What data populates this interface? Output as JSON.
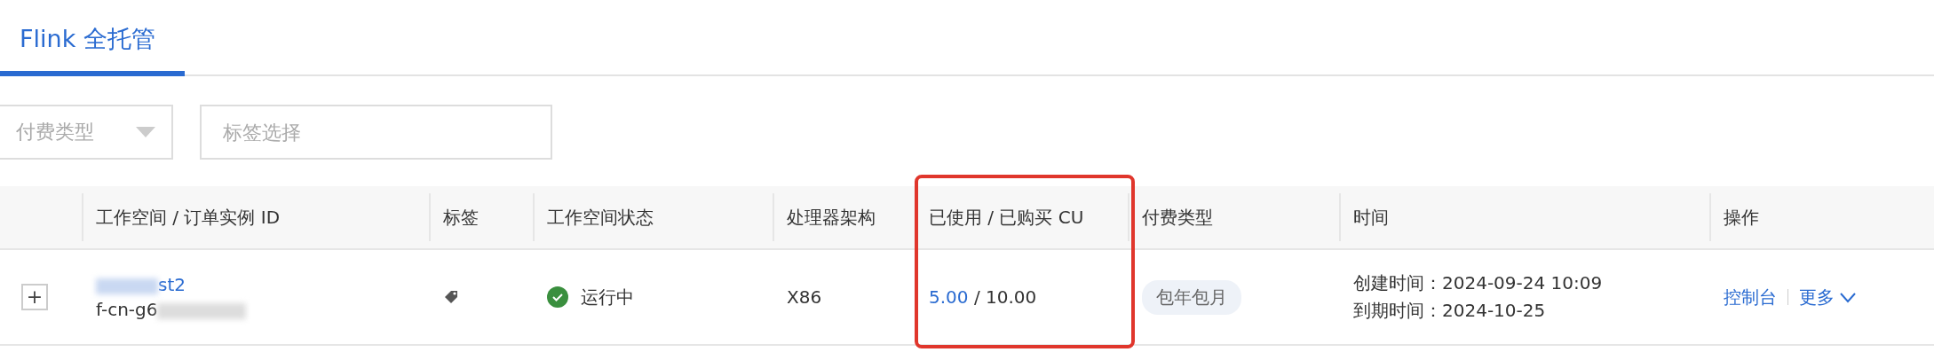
{
  "tabs": [
    {
      "label": "Flink 全托管",
      "selected": true
    }
  ],
  "filters": {
    "pay_type": {
      "placeholder": "付费类型"
    },
    "tags": {
      "placeholder": "标签选择"
    }
  },
  "table": {
    "columns": [
      "工作空间 / 订单实例 ID",
      "标签",
      "工作空间状态",
      "处理器架构",
      "已使用 / 已购买 CU",
      "付费类型",
      "时间",
      "操作"
    ],
    "rows": [
      {
        "expanded": false,
        "expand_symbol": "+",
        "workspace_name": "st2",
        "instance_id": "f-cn-g6",
        "status": "运行中",
        "kind": "running",
        "arch": "X86",
        "cu_used": "5.00",
        "cu_separator": "/",
        "cu_total": "10.00",
        "pay_type": "包年包月",
        "created": "创建时间：2024-09-24 10:09",
        "expires": "到期时间：2024-10-25",
        "actions": [
          "控制台",
          "更多"
        ]
      }
    ]
  },
  "cu_column_highlighted": true
}
